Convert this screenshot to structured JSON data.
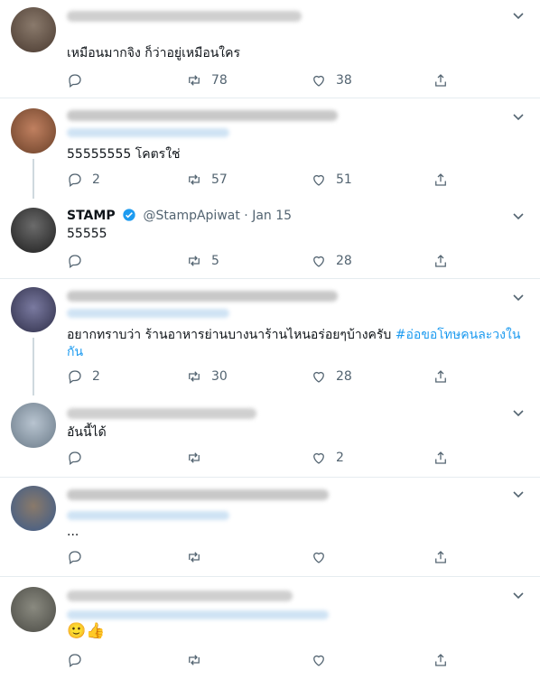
{
  "tweets": [
    {
      "text": "เหมือนมากจิง ก็ว่าอยู่เหมือนใคร",
      "reply": "",
      "retweet": "78",
      "like": "38"
    },
    {
      "text": "55555555 โคตรใช่",
      "reply": "2",
      "retweet": "57",
      "like": "51"
    },
    {
      "name": "STAMP",
      "handle": "@StampApiwat",
      "date": "· Jan 15",
      "text": "55555",
      "reply": "",
      "retweet": "5",
      "like": "28"
    },
    {
      "text_plain": "อยากทราบว่า ร้านอาหารย่านบางนาร้านไหนอร่อยๆบ้างครับ ",
      "hashtag": "#อ่อขอโทษคนละวงใน",
      "text_line2": "กัน",
      "reply": "2",
      "retweet": "30",
      "like": "28"
    },
    {
      "text": "อันนี้ได้",
      "reply": "",
      "retweet": "",
      "like": "2"
    },
    {
      "text": "...",
      "reply": "",
      "retweet": "",
      "like": ""
    },
    {
      "text": "🙂👍",
      "reply": "",
      "retweet": "",
      "like": ""
    }
  ]
}
